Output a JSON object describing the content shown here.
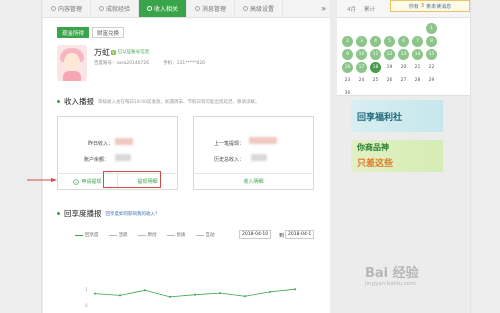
{
  "tabs": [
    {
      "label": "内容管理",
      "active": false
    },
    {
      "label": "成就经验",
      "active": false
    },
    {
      "label": "收入相关",
      "active": true
    },
    {
      "label": "消息管理",
      "active": false
    },
    {
      "label": "高级设置",
      "active": false
    }
  ],
  "tabs_more": "»",
  "subtabs": [
    {
      "label": "现金所得",
      "active": true
    },
    {
      "label": "财富兑换",
      "active": false
    }
  ],
  "profile": {
    "name": "万虹",
    "verified_label": "V",
    "verified_text": "已认证账号信息",
    "account_label": "百度账号：sara20140726",
    "phone_label": "手机：131*****020"
  },
  "income": {
    "title": "收入播报",
    "note": "审核收入会在每日18:00前发放，如遇周末、节假日等可能出现延迟，敬请谅解。",
    "left_card": {
      "yesterday_label": "昨日收入：",
      "balance_label": "账户余额：",
      "apply_label": "申请提现",
      "apply_icon": "circle-i-icon",
      "detail_label": "提现明细"
    },
    "right_card": {
      "last_label": "上一笔提现：",
      "total_label": "历史总收入：",
      "detail_label": "收入明细"
    }
  },
  "quarter": {
    "title": "回享度播报",
    "link": "回享度如何影响我的收入？",
    "legend": [
      "回享度",
      "活跃",
      "原创",
      "优质",
      "互动"
    ],
    "date_from": "2018-04-10",
    "date_to": "2018-04-1",
    "date_sep": "到"
  },
  "chart_data": {
    "type": "line",
    "series": [
      {
        "name": "回享度",
        "values": [
          0.7,
          0.62,
          0.85,
          0.55,
          0.65,
          0.72,
          0.58,
          0.78,
          0.9
        ]
      }
    ],
    "y_tick_labels": [
      "0",
      "1"
    ],
    "y_tick_values": [
      0,
      1
    ]
  },
  "calendar": {
    "month_label": "4月",
    "sum_label": "累计",
    "days": [
      {
        "d": "",
        "s": ""
      },
      {
        "d": "",
        "s": ""
      },
      {
        "d": "",
        "s": ""
      },
      {
        "d": "",
        "s": ""
      },
      {
        "d": "",
        "s": ""
      },
      {
        "d": "",
        "s": ""
      },
      {
        "d": "1",
        "s": "g"
      },
      {
        "d": "2",
        "s": "g"
      },
      {
        "d": "3",
        "s": "g"
      },
      {
        "d": "4",
        "s": "g"
      },
      {
        "d": "5",
        "s": "g"
      },
      {
        "d": "6",
        "s": "g"
      },
      {
        "d": "7",
        "s": "g"
      },
      {
        "d": "8",
        "s": "g"
      },
      {
        "d": "9",
        "s": "g"
      },
      {
        "d": "10",
        "s": "g"
      },
      {
        "d": "11",
        "s": "g"
      },
      {
        "d": "12",
        "s": "g"
      },
      {
        "d": "13",
        "s": "g"
      },
      {
        "d": "14",
        "s": "g"
      },
      {
        "d": "15",
        "s": "g"
      },
      {
        "d": "16",
        "s": "g"
      },
      {
        "d": "17",
        "s": "g"
      },
      {
        "d": "18",
        "s": "today"
      },
      {
        "d": "19",
        "s": ""
      },
      {
        "d": "20",
        "s": ""
      },
      {
        "d": "21",
        "s": ""
      },
      {
        "d": "22",
        "s": ""
      },
      {
        "d": "23",
        "s": ""
      },
      {
        "d": "24",
        "s": ""
      },
      {
        "d": "25",
        "s": ""
      },
      {
        "d": "26",
        "s": ""
      },
      {
        "d": "27",
        "s": ""
      },
      {
        "d": "28",
        "s": ""
      },
      {
        "d": "29",
        "s": ""
      },
      {
        "d": "30",
        "s": ""
      }
    ]
  },
  "popup": {
    "pre": "你有",
    "count": "3",
    "post": "条未读消息"
  },
  "banners": {
    "b1_text": "回享福利社",
    "b2_line1": "你商品神",
    "b2_line2": "只差这些"
  },
  "watermark": {
    "main": "Bai 经验",
    "sub": "jingyan.baidu.com"
  }
}
